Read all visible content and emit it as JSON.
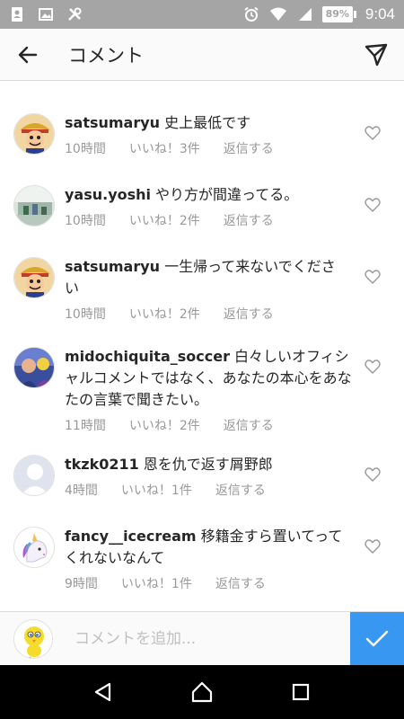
{
  "status_bar": {
    "battery": "89%",
    "time": "9:04"
  },
  "header": {
    "title": "コメント",
    "back_icon": "arrow-left-icon",
    "send_icon": "paper-plane-icon"
  },
  "comments": [
    {
      "user": "satsumaryu",
      "text": "史上最低です",
      "time": "10時間",
      "likes": "いいね！3件",
      "reply": "返信する",
      "avatar": "cartoon-pirate"
    },
    {
      "user": "yasu.yoshi",
      "text": "やり方が間違ってる。",
      "time": "10時間",
      "likes": "いいね！2件",
      "reply": "返信する",
      "avatar": "photo-room"
    },
    {
      "user": "satsumaryu",
      "text": "一生帰って来ないでくださ い",
      "time": "10時間",
      "likes": "いいね！2件",
      "reply": "返信する",
      "avatar": "cartoon-pirate"
    },
    {
      "user": "midochiquita_soccer",
      "text": "白々しいオフィシャルコメントではなく、あなたの本心をあなたの言葉で聞きたい。",
      "time": "11時間",
      "likes": "いいね！2件",
      "reply": "返信する",
      "avatar": "photo-people"
    },
    {
      "user": "tkzk0211",
      "text": "恩を仇で返す屑野郎",
      "time": "4時間",
      "likes": "いいね！1件",
      "reply": "返信する",
      "avatar": "default-silhouette"
    },
    {
      "user": "fancy__icecream",
      "text": "移籍金すら置いてってくれないなんて",
      "time": "9時間",
      "likes": "いいね！1件",
      "reply": "返信する",
      "avatar": "unicorn"
    }
  ],
  "composer": {
    "placeholder": "コメントを追加...",
    "avatar": "yellow-bird",
    "post_icon": "checkmark-icon"
  },
  "colors": {
    "status_bar": "#a5a5a5",
    "accent": "#3897f0",
    "meta_text": "#999999"
  }
}
